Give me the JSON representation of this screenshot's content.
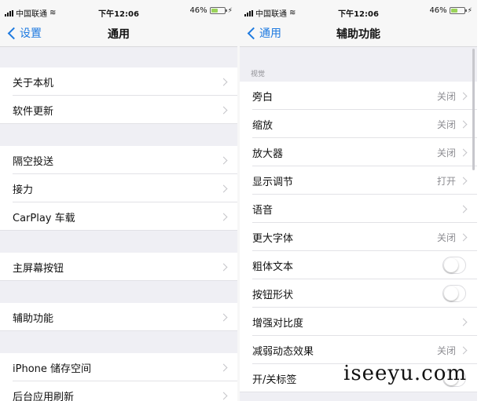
{
  "status": {
    "carrier": "中国联通",
    "time": "下午12:06",
    "battery": "46%"
  },
  "left": {
    "back_label": "设置",
    "title": "通用",
    "rows": [
      {
        "label": "关于本机"
      },
      {
        "label": "软件更新"
      },
      {
        "label": "隔空投送"
      },
      {
        "label": "接力"
      },
      {
        "label": "CarPlay 车载"
      },
      {
        "label": "主屏幕按钮"
      },
      {
        "label": "辅助功能"
      },
      {
        "label": "iPhone 储存空间"
      },
      {
        "label": "后台应用刷新"
      }
    ]
  },
  "right": {
    "back_label": "通用",
    "title": "辅助功能",
    "section_vision": "视觉",
    "rows": [
      {
        "label": "旁白",
        "value": "关闭"
      },
      {
        "label": "缩放",
        "value": "关闭"
      },
      {
        "label": "放大器",
        "value": "关闭"
      },
      {
        "label": "显示调节",
        "value": "打开"
      },
      {
        "label": "语音",
        "value": ""
      },
      {
        "label": "更大字体",
        "value": "关闭"
      },
      {
        "label": "粗体文本",
        "toggle": false
      },
      {
        "label": "按钮形状",
        "toggle": false
      },
      {
        "label": "增强对比度",
        "value": ""
      },
      {
        "label": "减弱动态效果",
        "value": "关闭"
      },
      {
        "label": "开/关标签",
        "toggle": false
      }
    ]
  },
  "watermark": "iseeyu.com"
}
